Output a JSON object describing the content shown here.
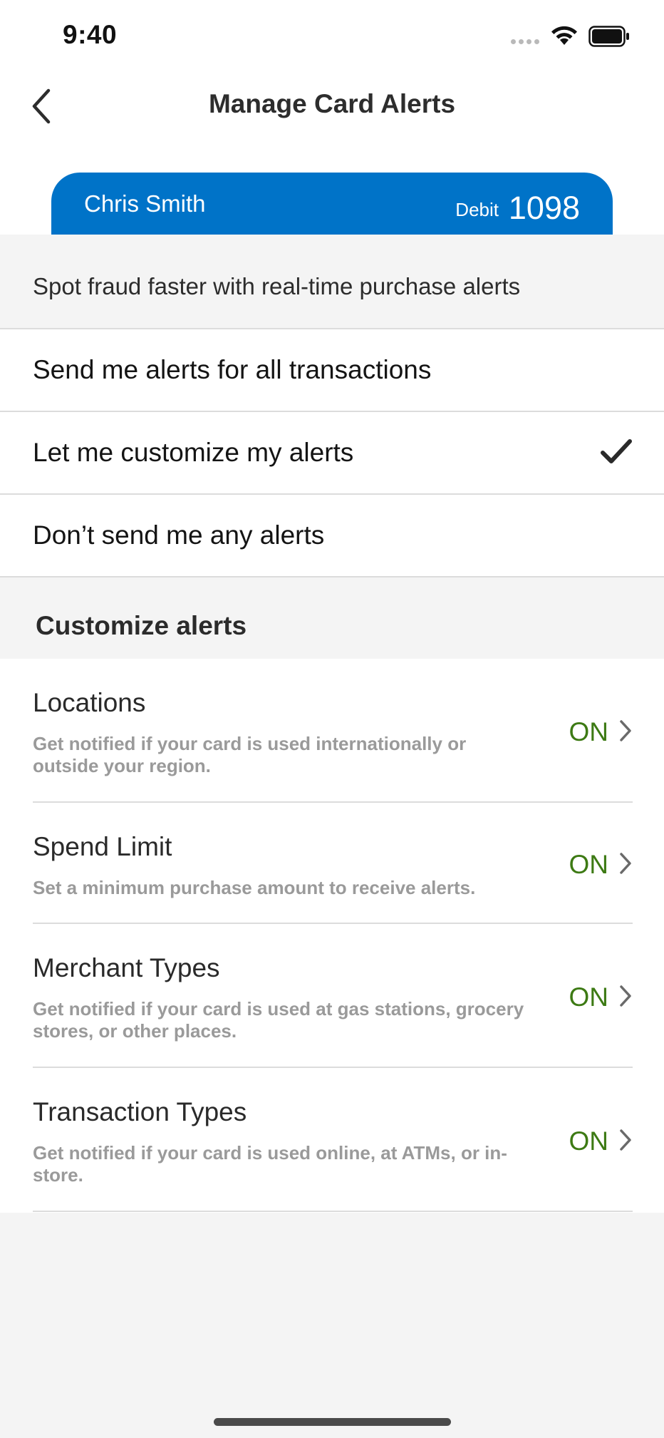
{
  "status_bar": {
    "time": "9:40"
  },
  "nav": {
    "title": "Manage Card Alerts",
    "back_icon": "chevron-left-icon"
  },
  "card": {
    "holder_name": "Chris Smith",
    "type": "Debit",
    "last_digits": "1098",
    "color": "#0073c8"
  },
  "intro_text": "Spot fraud faster with real-time purchase alerts",
  "options": [
    {
      "label": "Send me alerts for all transactions",
      "selected": false
    },
    {
      "label": "Let me customize my alerts",
      "selected": true
    },
    {
      "label": "Don’t send me any alerts",
      "selected": false
    }
  ],
  "customize": {
    "section_title": "Customize alerts",
    "items": [
      {
        "title": "Locations",
        "description": "Get notified if your card is used internationally or outside your region.",
        "status": "ON"
      },
      {
        "title": "Spend Limit",
        "description": "Set a minimum purchase amount to receive alerts.",
        "status": "ON"
      },
      {
        "title": "Merchant Types",
        "description": "Get notified if your card is used at gas stations, grocery stores, or other places.",
        "status": "ON"
      },
      {
        "title": "Transaction Types",
        "description": "Get notified if your card is used online, at ATMs, or in-store.",
        "status": "ON"
      }
    ]
  },
  "colors": {
    "accent_on": "#3d7a14",
    "card_blue": "#0073c8",
    "background": "#f4f4f4"
  }
}
